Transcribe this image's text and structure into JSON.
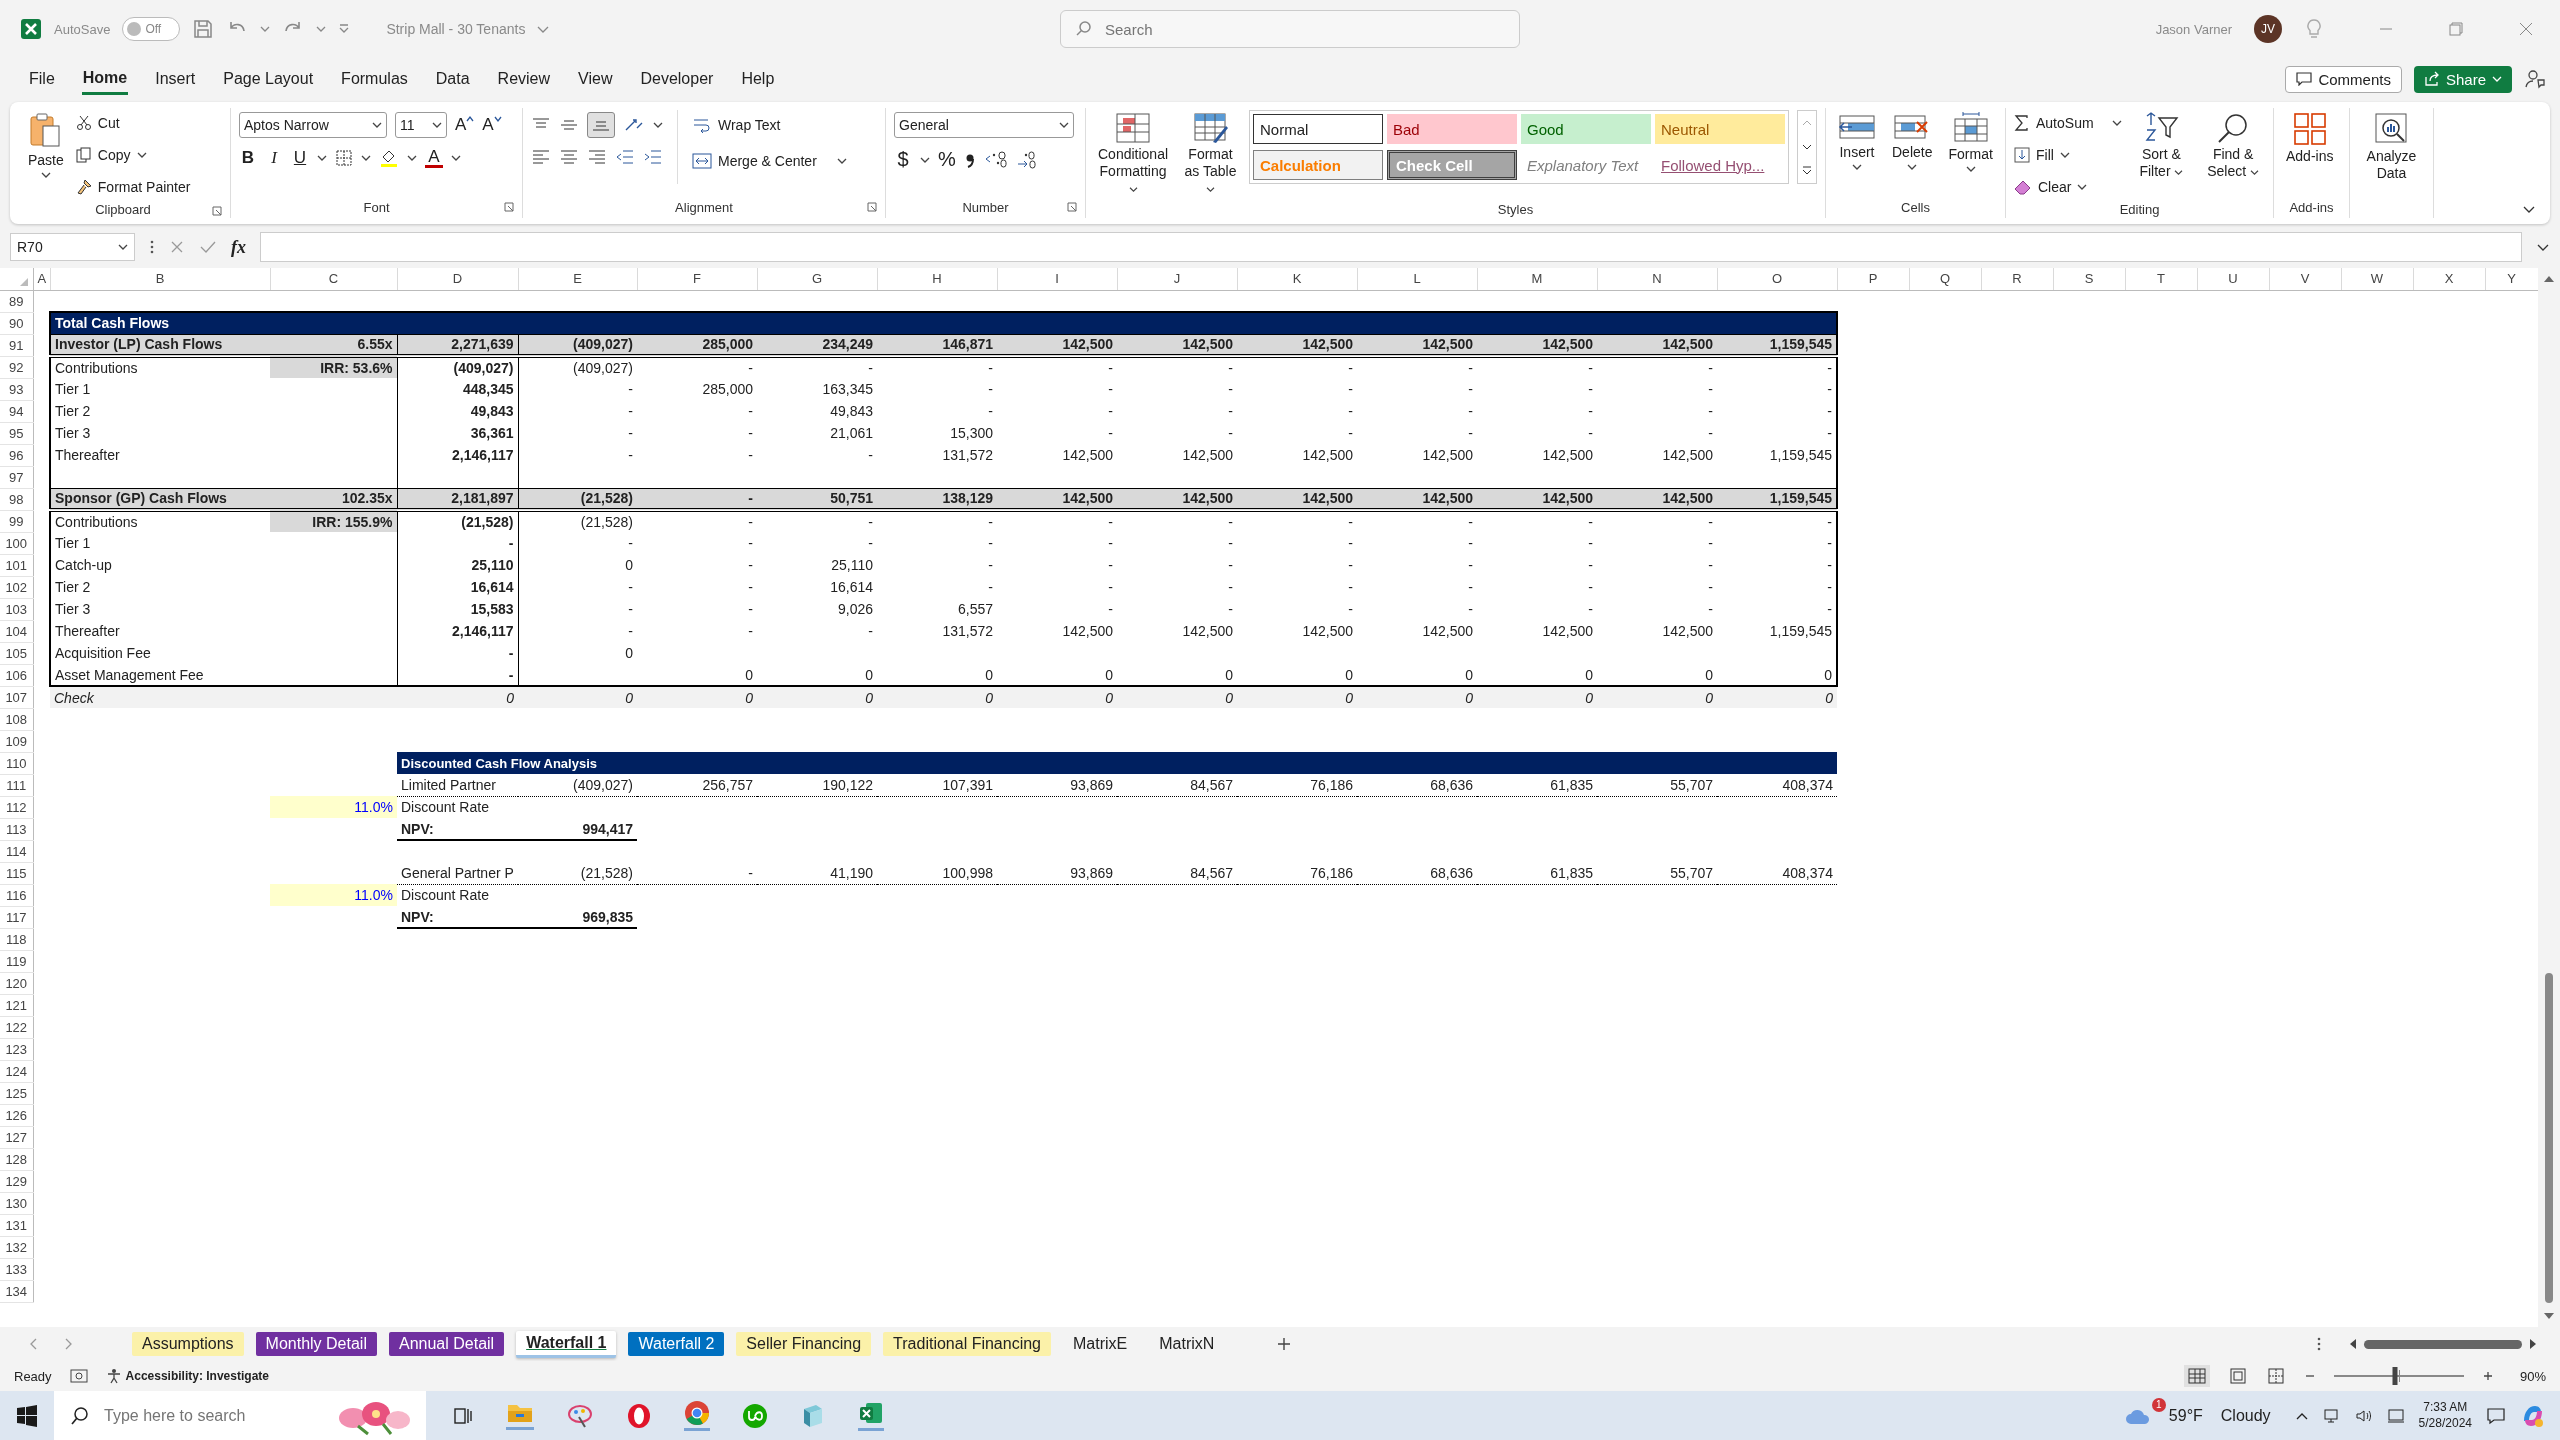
{
  "title_bar": {
    "autosave_label": "AutoSave",
    "autosave": {
      "on": false,
      "label": "Off"
    },
    "file_title": "Strip Mall - 30 Tenants",
    "search_placeholder": "Search",
    "user_name": "Jason Varner",
    "user_initials": "JV"
  },
  "menu_tabs": [
    {
      "label": "File",
      "selected": false
    },
    {
      "label": "Home",
      "selected": true
    },
    {
      "label": "Insert",
      "selected": false
    },
    {
      "label": "Page Layout",
      "selected": false
    },
    {
      "label": "Formulas",
      "selected": false
    },
    {
      "label": "Data",
      "selected": false
    },
    {
      "label": "Review",
      "selected": false
    },
    {
      "label": "View",
      "selected": false
    },
    {
      "label": "Developer",
      "selected": false
    },
    {
      "label": "Help",
      "selected": false
    }
  ],
  "comments_button": "Comments",
  "share_button": "Share",
  "ribbon": {
    "clipboard": {
      "paste": "Paste",
      "cut": "Cut",
      "copy": "Copy",
      "format_painter": "Format Painter",
      "label": "Clipboard"
    },
    "font": {
      "family": "Aptos Narrow",
      "size": "11",
      "grow": "A",
      "shrink": "A",
      "bold": "B",
      "italic": "I",
      "underline": "U",
      "color_letter": "A",
      "label": "Font"
    },
    "alignment": {
      "wrap_text": "Wrap Text",
      "merge_center": "Merge & Center",
      "label": "Alignment"
    },
    "number": {
      "format": "General",
      "currency": "$",
      "percent": "%",
      "label": "Number"
    },
    "conditional_formatting": "Conditional Formatting",
    "format_as_table": "Format as Table",
    "styles": {
      "gallery": [
        {
          "label": "Normal",
          "kind": "normal"
        },
        {
          "label": "Bad",
          "kind": "bad"
        },
        {
          "label": "Good",
          "kind": "good"
        },
        {
          "label": "Neutral",
          "kind": "neutral"
        },
        {
          "label": "Calculation",
          "kind": "calculation"
        },
        {
          "label": "Check Cell",
          "kind": "check"
        },
        {
          "label": "Explanatory Text",
          "kind": "explanatory"
        },
        {
          "label": "Followed Hyp...",
          "kind": "followed"
        }
      ],
      "label": "Styles"
    },
    "cells": {
      "insert": "Insert",
      "delete": "Delete",
      "format": "Format",
      "label": "Cells"
    },
    "editing": {
      "autosum": "AutoSum",
      "fill": "Fill",
      "clear": "Clear",
      "sort_filter": "Sort & Filter",
      "find_select": "Find & Select",
      "label": "Editing"
    },
    "addins": {
      "button": "Add-ins",
      "label": "Add-ins"
    },
    "analyze_data": "Analyze Data"
  },
  "formula_bar": {
    "name_box": "R70",
    "function_label": "fx"
  },
  "sheet": {
    "columns": [
      "A",
      "B",
      "C",
      "D",
      "E",
      "F",
      "G",
      "H",
      "I",
      "J",
      "K",
      "L",
      "M",
      "N",
      "O",
      "P",
      "Q",
      "R",
      "S",
      "T",
      "U",
      "V",
      "W",
      "X",
      "Y"
    ],
    "rows": [
      {
        "number": "89"
      },
      {
        "number": "90",
        "kind": "title",
        "cells": [
          "Total Cash Flows"
        ]
      },
      {
        "number": "91",
        "kind": "total",
        "cells": [
          "Investor (LP) Cash Flows",
          "6.55x",
          "2,271,639",
          "(409,027)",
          "285,000",
          "234,249",
          "146,871",
          "142,500",
          "142,500",
          "142,500",
          "142,500",
          "142,500",
          "142,500",
          "1,159,545"
        ]
      },
      {
        "number": "92",
        "kind": "detail",
        "cells": [
          "Contributions",
          "IRR: 53.6%",
          "(409,027)",
          "(409,027)",
          "-",
          "-",
          "-",
          "-",
          "-",
          "-",
          "-",
          "-",
          "-",
          "-"
        ]
      },
      {
        "number": "93",
        "kind": "detail",
        "cells": [
          "Tier 1",
          null,
          "448,345",
          "-",
          "285,000",
          "163,345",
          "-",
          "-",
          "-",
          "-",
          "-",
          "-",
          "-",
          "-"
        ]
      },
      {
        "number": "94",
        "kind": "detail",
        "cells": [
          "Tier 2",
          null,
          "49,843",
          "-",
          "-",
          "49,843",
          "-",
          "-",
          "-",
          "-",
          "-",
          "-",
          "-",
          "-"
        ]
      },
      {
        "number": "95",
        "kind": "detail",
        "cells": [
          "Tier 3",
          null,
          "36,361",
          "-",
          "-",
          "21,061",
          "15,300",
          "-",
          "-",
          "-",
          "-",
          "-",
          "-",
          "-"
        ]
      },
      {
        "number": "96",
        "kind": "detail",
        "cells": [
          "Thereafter",
          null,
          "2,146,117",
          "-",
          "-",
          "-",
          "131,572",
          "142,500",
          "142,500",
          "142,500",
          "142,500",
          "142,500",
          "142,500",
          "1,159,545"
        ]
      },
      {
        "number": "97",
        "kind": "spacer"
      },
      {
        "number": "98",
        "kind": "total",
        "cells": [
          "Sponsor (GP) Cash Flows",
          "102.35x",
          "2,181,897",
          "(21,528)",
          "-",
          "50,751",
          "138,129",
          "142,500",
          "142,500",
          "142,500",
          "142,500",
          "142,500",
          "142,500",
          "1,159,545"
        ]
      },
      {
        "number": "99",
        "kind": "detail",
        "cells": [
          "Contributions",
          "IRR: 155.9%",
          "(21,528)",
          "(21,528)",
          "-",
          "-",
          "-",
          "-",
          "-",
          "-",
          "-",
          "-",
          "-",
          "-"
        ]
      },
      {
        "number": "100",
        "kind": "detail",
        "cells": [
          "Tier 1",
          null,
          "-",
          "-",
          "-",
          "-",
          "-",
          "-",
          "-",
          "-",
          "-",
          "-",
          "-",
          "-"
        ]
      },
      {
        "number": "101",
        "kind": "detail",
        "cells": [
          "Catch-up",
          null,
          "25,110",
          "0",
          "-",
          "25,110",
          "-",
          "-",
          "-",
          "-",
          "-",
          "-",
          "-",
          "-"
        ]
      },
      {
        "number": "102",
        "kind": "detail",
        "cells": [
          "Tier 2",
          null,
          "16,614",
          "-",
          "-",
          "16,614",
          "-",
          "-",
          "-",
          "-",
          "-",
          "-",
          "-",
          "-"
        ]
      },
      {
        "number": "103",
        "kind": "detail",
        "cells": [
          "Tier 3",
          null,
          "15,583",
          "-",
          "-",
          "9,026",
          "6,557",
          "-",
          "-",
          "-",
          "-",
          "-",
          "-",
          "-"
        ]
      },
      {
        "number": "104",
        "kind": "detail",
        "cells": [
          "Thereafter",
          null,
          "2,146,117",
          "-",
          "-",
          "-",
          "131,572",
          "142,500",
          "142,500",
          "142,500",
          "142,500",
          "142,500",
          "142,500",
          "1,159,545"
        ]
      },
      {
        "number": "105",
        "kind": "detail",
        "cells": [
          "Acquisition Fee",
          null,
          "-",
          "0"
        ]
      },
      {
        "number": "106",
        "kind": "detail",
        "cells": [
          "Asset Management Fee",
          null,
          "-",
          null,
          "0",
          "0",
          "0",
          "0",
          "0",
          "0",
          "0",
          "0",
          "0",
          "0"
        ]
      },
      {
        "number": "107",
        "kind": "check",
        "cells": [
          "Check",
          null,
          "0",
          "0",
          "0",
          "0",
          "0",
          "0",
          "0",
          "0",
          "0",
          "0",
          "0",
          "0"
        ]
      },
      {
        "number": "108"
      },
      {
        "number": "109"
      },
      {
        "number": "110",
        "kind": "dcf_title",
        "cells": [
          null,
          null,
          "Discounted Cash Flow Analysis"
        ]
      },
      {
        "number": "111",
        "kind": "dcf",
        "cells": [
          null,
          null,
          "Limited Partner",
          "(409,027)",
          "256,757",
          "190,122",
          "107,391",
          "93,869",
          "84,567",
          "76,186",
          "68,636",
          "61,835",
          "55,707",
          "408,374"
        ]
      },
      {
        "number": "112",
        "kind": "rate",
        "cells": [
          null,
          "11.0%",
          "Discount Rate"
        ]
      },
      {
        "number": "113",
        "kind": "npv",
        "cells": [
          null,
          null,
          "NPV:",
          "994,417"
        ]
      },
      {
        "number": "114"
      },
      {
        "number": "115",
        "kind": "dcf",
        "cells": [
          null,
          null,
          "General Partner P",
          "(21,528)",
          "-",
          "41,190",
          "100,998",
          "93,869",
          "84,567",
          "76,186",
          "68,636",
          "61,835",
          "55,707",
          "408,374"
        ]
      },
      {
        "number": "116",
        "kind": "rate",
        "cells": [
          null,
          "11.0%",
          "Discount Rate"
        ]
      },
      {
        "number": "117",
        "kind": "npv",
        "cells": [
          null,
          null,
          "NPV:",
          "969,835"
        ]
      },
      {
        "number": "118"
      },
      {
        "number": "119"
      },
      {
        "number": "120"
      },
      {
        "number": "121"
      },
      {
        "number": "122"
      },
      {
        "number": "123"
      },
      {
        "number": "124"
      },
      {
        "number": "125"
      },
      {
        "number": "126"
      },
      {
        "number": "127"
      },
      {
        "number": "128"
      },
      {
        "number": "129"
      },
      {
        "number": "130"
      },
      {
        "number": "131"
      },
      {
        "number": "132"
      },
      {
        "number": "133"
      },
      {
        "number": "134"
      }
    ]
  },
  "sheet_tabs": [
    {
      "label": "Assumptions",
      "color": "#fbf1a9",
      "selected": false
    },
    {
      "label": "Monthly Detail",
      "color": "#7030a0",
      "selected": false
    },
    {
      "label": "Annual Detail",
      "color": "#7030a0",
      "selected": false
    },
    {
      "label": "Waterfall 1",
      "color": "#9dc3e6",
      "selected": true
    },
    {
      "label": "Waterfall 2",
      "color": "#0070c0",
      "selected": false
    },
    {
      "label": "Seller Financing",
      "color": "#fbf1a9",
      "selected": false
    },
    {
      "label": "Traditional Financing",
      "color": "#fbf1a9",
      "selected": false
    },
    {
      "label": "MatrixE",
      "selected": false
    },
    {
      "label": "MatrixN",
      "selected": false
    }
  ],
  "status_bar": {
    "ready": "Ready",
    "accessibility": "Accessibility: Investigate",
    "zoom": {
      "level": 0.47,
      "reading": "90%"
    }
  },
  "taskbar": {
    "search_placeholder": "Type here to search",
    "weather_badge": "1",
    "weather_temp": "59°F",
    "weather_text": "Cloudy",
    "time": "7:33 AM",
    "date": "5/28/2024"
  }
}
